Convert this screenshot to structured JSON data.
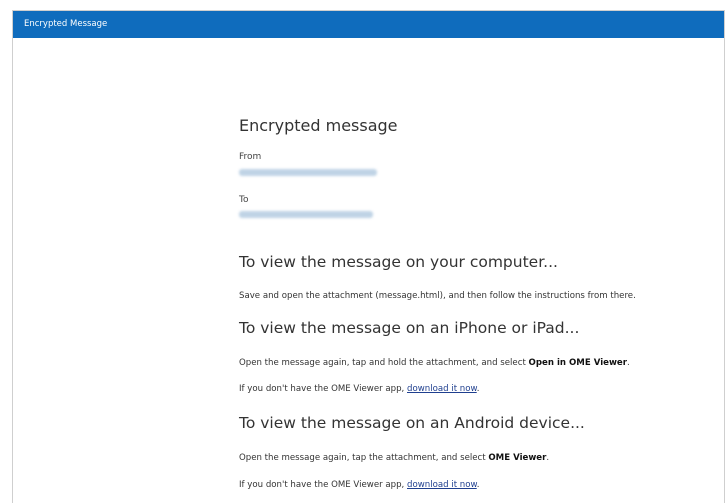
{
  "window": {
    "title": "Encrypted Message"
  },
  "message": {
    "heading": "Encrypted message",
    "from_label": "From",
    "to_label": "To"
  },
  "sections": {
    "computer": {
      "heading": "To view the message on your computer...",
      "text": "Save and open the attachment (message.html), and then follow the instructions from there."
    },
    "iphone": {
      "heading": "To view the message on an iPhone or iPad...",
      "text_before": "Open the message again, tap and hold the attachment, and select ",
      "text_bold": "Open in OME Viewer",
      "text_after": ".",
      "app_text": "If you don't have the OME Viewer app, ",
      "link": "download it now",
      "app_after": "."
    },
    "android": {
      "heading": "To view the message on an Android device...",
      "text_before": "Open the message again, tap the attachment, and select ",
      "text_bold": "OME Viewer",
      "text_after": ".",
      "app_text": "If you don't have the OME Viewer app, ",
      "link": "download it now",
      "app_after": "."
    }
  }
}
